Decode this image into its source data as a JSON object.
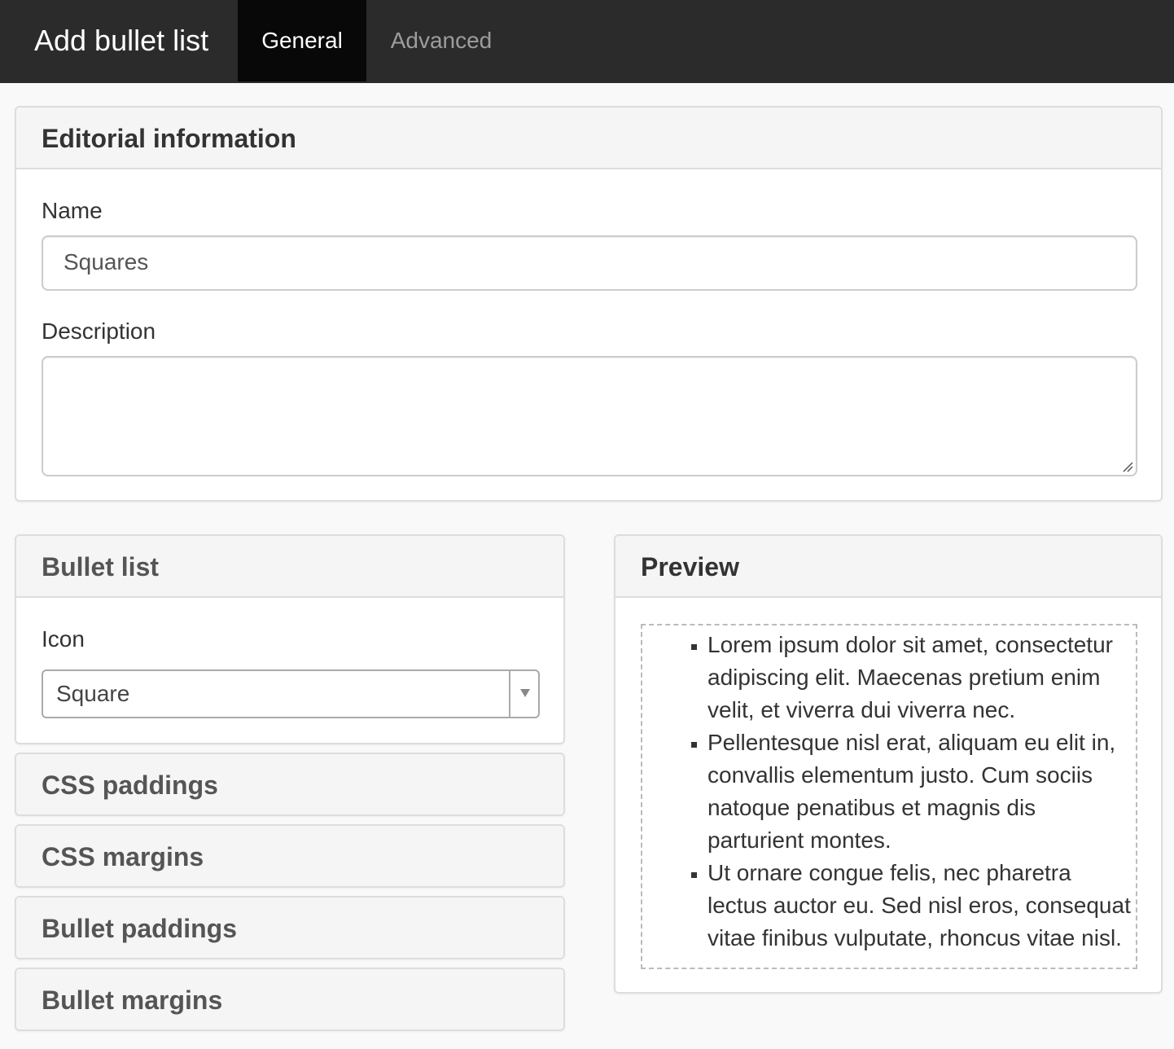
{
  "header": {
    "title": "Add bullet list",
    "tabs": [
      {
        "label": "General",
        "active": true
      },
      {
        "label": "Advanced",
        "active": false
      }
    ]
  },
  "editorial": {
    "heading": "Editorial information",
    "name_label": "Name",
    "name_value": "Squares",
    "description_label": "Description",
    "description_value": ""
  },
  "bullet_list": {
    "heading": "Bullet list",
    "icon_label": "Icon",
    "icon_selected": "Square"
  },
  "sections": {
    "css_paddings": "CSS paddings",
    "css_margins": "CSS margins",
    "bullet_paddings": "Bullet paddings",
    "bullet_margins": "Bullet margins"
  },
  "preview": {
    "heading": "Preview",
    "items": [
      "Lorem ipsum dolor sit amet, consectetur adipiscing elit. Maecenas pretium enim velit, et viverra dui viverra nec.",
      "Pellentesque nisl erat, aliquam eu elit in, convallis elementum justo. Cum sociis natoque penatibus et magnis dis parturient montes.",
      "Ut ornare congue felis, nec pharetra lectus auctor eu. Sed nisl eros, consequat vitae finibus vulputate, rhoncus vitae nisl."
    ]
  },
  "colors": {
    "topbar": "#2b2b2b",
    "active_tab": "#080808",
    "inactive_tab_text": "#9d9d9d",
    "panel_heading_bg": "#f5f5f5"
  }
}
